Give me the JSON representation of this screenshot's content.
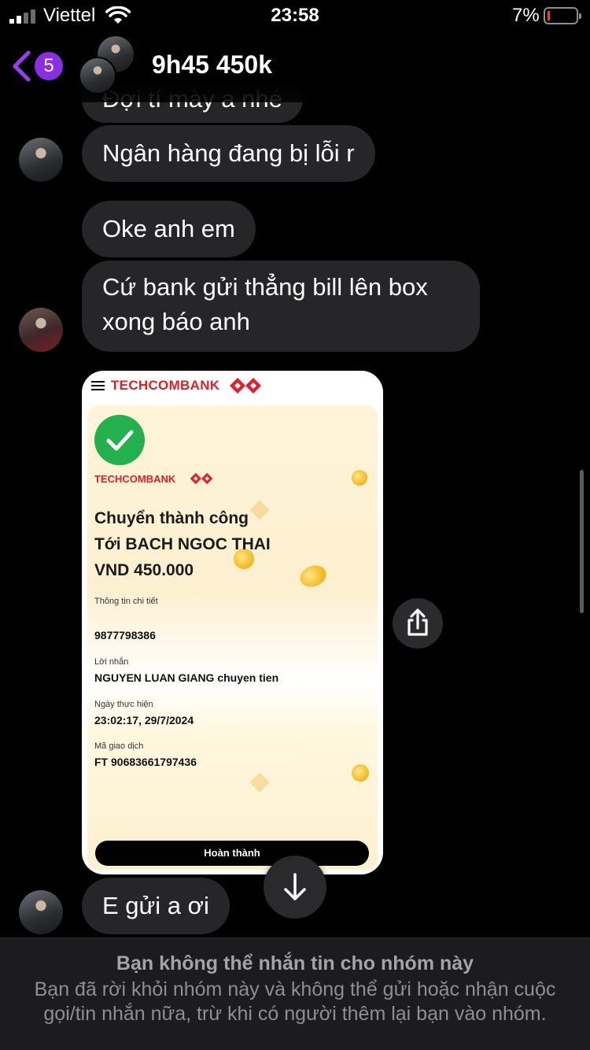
{
  "status_bar": {
    "carrier": "Viettel",
    "time": "23:58",
    "battery_percent": "7%",
    "battery_level": 0.07,
    "battery_color": "#ff3b30"
  },
  "header": {
    "back_count": "5",
    "title": "9h45 450k",
    "accent_color": "#8a2ee6"
  },
  "messages": [
    {
      "text": "Đợi tí mày a nhé",
      "partial": true
    },
    {
      "text": "Ngân hàng đang bị lỗi r"
    },
    {
      "text": "Oke anh em"
    },
    {
      "text": "Cứ bank gửi thẳng bill lên box xong báo anh"
    },
    {
      "text": "E gửi a ơi"
    }
  ],
  "receipt": {
    "bank_name": "TECHCOMBANK",
    "status": "Chuyển thành công",
    "recipient": "Tới BACH NGOC THAI",
    "amount": "VND 450.000",
    "details_label": "Thông tin chi tiết",
    "account_number": "9877798386",
    "message_label": "Lời nhắn",
    "message_value": "NGUYEN LUAN GIANG chuyen tien",
    "date_label": "Ngày thực hiện",
    "date_value": "23:02:17, 29/7/2024",
    "transaction_label": "Mã giao dịch",
    "transaction_value": "FT 90683661797436",
    "done_button": "Hoàn thành",
    "brand_color": "#e41e26",
    "success_color": "#23b14d"
  },
  "icons": {
    "share": "share-icon",
    "scroll_down": "arrow-down-icon",
    "back": "chevron-left-icon"
  },
  "notice": {
    "title": "Bạn không thể nhắn tin cho nhóm này",
    "body": "Bạn đã rời khỏi nhóm này và không thể gửi hoặc nhận cuộc gọi/tin nhắn nữa, trừ khi có người thêm lại bạn vào nhóm."
  }
}
